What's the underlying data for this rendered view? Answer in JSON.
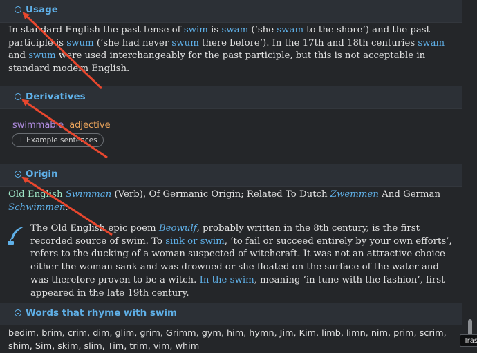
{
  "usage": {
    "title": "Usage",
    "t1": "In standard English the past tense of ",
    "l1": "swim",
    "t2": " is ",
    "l2": "swam",
    "t3": " (‘she ",
    "l3": "swam",
    "t4": " to the shore’) and the past participle is ",
    "l4": "swum",
    "t5": " (‘she had never ",
    "l5": "swum",
    "t6": " there before’). In the 17th and 18th centuries ",
    "l6": "swam",
    "t7": " and ",
    "l7": "swum",
    "t8": " were used interchangeably for the past participle, but this is not acceptable in standard modern English."
  },
  "derivatives": {
    "title": "Derivatives",
    "word": "swimmable",
    "pos": "adjective",
    "example_button": "+ Example sentences"
  },
  "origin": {
    "title": "Origin",
    "e1": "Old English",
    "e2": " ",
    "e3": "Swimman",
    "e4": " (Verb), Of Germanic Origin; Related To Dutch ",
    "e5": "Zwemmen",
    "e6": " And German ",
    "e7": "Schwimmen",
    "e8": ".",
    "n1": "The Old English epic poem ",
    "n2": "Beowulf",
    "n3": ", probably written in the 8th century, is the first recorded source of swim. To ",
    "n4": "sink or swim",
    "n5": ", ‘to fail or succeed entirely by your own efforts’, refers to the ducking of a woman suspected of witchcraft. It was not an attractive choice—either the woman sank and was drowned or she floated on the surface of the water and was therefore proven to be a witch. ",
    "n6": "In the swim",
    "n7": ", meaning ‘in tune with the fashion’, first appeared in the late 19th century."
  },
  "rhymes": {
    "title": "Words that rhyme with swim",
    "list": "bedim, brim, crim, dim, glim, grim, Grimm, gym, him, hymn, Jim, Kim, limb, limn, nim, prim, scrim, shim, Sim, skim, slim, Tim, trim, vim, whim"
  },
  "tooltip": "Trash",
  "colors": {
    "accent": "#5fb0e8",
    "arrow": "#e8472e",
    "derivative_word": "#b08ce0",
    "part_of_speech": "#e9a35a",
    "etymology": "#9ee6c6"
  }
}
